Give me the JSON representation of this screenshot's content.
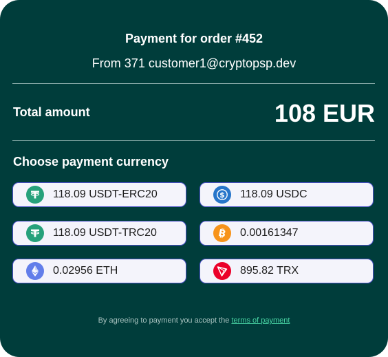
{
  "order": {
    "title": "Payment for order #452",
    "from_line": "From 371 customer1@cryptopsp.dev"
  },
  "total": {
    "label": "Total amount",
    "value": "108 EUR"
  },
  "currency_section": {
    "heading": "Choose payment currency",
    "options": [
      {
        "label": "118.09 USDT-ERC20",
        "icon": "tether-icon",
        "color": "#26a17b"
      },
      {
        "label": "118.09 USDC",
        "icon": "usdc-icon",
        "color": "#2775ca"
      },
      {
        "label": "118.09 USDT-TRC20",
        "icon": "tether-icon",
        "color": "#26a17b"
      },
      {
        "label": "0.00161347",
        "icon": "bitcoin-icon",
        "color": "#f7931a"
      },
      {
        "label": "0.02956 ETH",
        "icon": "ethereum-icon",
        "color": "#627eea"
      },
      {
        "label": "895.82 TRX",
        "icon": "tron-icon",
        "color": "#eb0029"
      }
    ]
  },
  "footer": {
    "text": "By agreeing to payment you accept the",
    "link": "terms of payment"
  },
  "colors": {
    "background": "#003d3b",
    "option_bg": "#f4f4fb",
    "option_border": "#4a50c8",
    "link": "#49d6a5"
  }
}
